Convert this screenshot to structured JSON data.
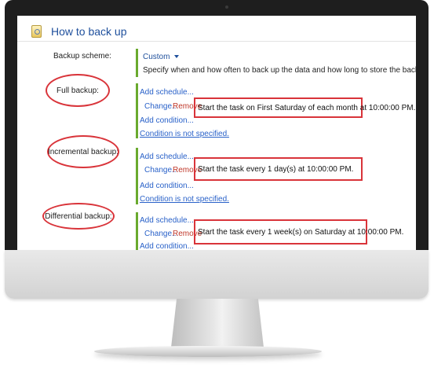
{
  "window": {
    "title": "How to back up"
  },
  "scheme": {
    "label": "Backup scheme:",
    "value": "Custom",
    "description": "Specify when and how often to back up the data and how long to store the backups."
  },
  "sections": [
    {
      "label": "Full backup:",
      "add_schedule": "Add schedule...",
      "change": "Change...",
      "remove": "Remove",
      "task": "Start the task on First Saturday of each month at 10:00:00 PM.",
      "add_condition": "Add condition...",
      "condition_status": "Condition is not specified."
    },
    {
      "label": "Incremental backup:",
      "add_schedule": "Add schedule...",
      "change": "Change...",
      "remove": "Remove",
      "task": "Start the task every 1 day(s) at 10:00:00 PM.",
      "add_condition": "Add condition...",
      "condition_status": "Condition is not specified."
    },
    {
      "label": "Differential backup:",
      "add_schedule": "Add schedule...",
      "change": "Change...",
      "remove": "Remove",
      "task": "Start the task every 1 week(s) on Saturday at 10:00:00 PM.",
      "add_condition": "Add condition..."
    }
  ],
  "colors": {
    "title": "#1e4f9c",
    "link": "#2a62c9",
    "remove": "#c0392b",
    "highlight": "#d9343a",
    "accent_bar": "#6aaa2e"
  }
}
